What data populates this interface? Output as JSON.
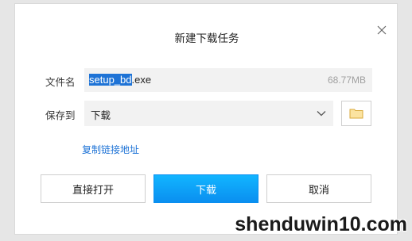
{
  "dialog": {
    "title": "新建下载任务",
    "close_icon": "close-icon"
  },
  "filename": {
    "label": "文件名",
    "value_selected": "setup_bd",
    "value_rest": ".exe",
    "size": "68.77MB"
  },
  "save_to": {
    "label": "保存到",
    "value": "下载",
    "dropdown_icon": "chevron-down-icon",
    "folder_icon": "folder-icon"
  },
  "copy_link": {
    "label": "复制链接地址"
  },
  "buttons": {
    "open_direct": "直接打开",
    "download": "下载",
    "cancel": "取消"
  },
  "watermark": {
    "text": "shenduwin10.com"
  },
  "colors": {
    "accent": "#1e73d6",
    "primary_button": "#0a9cf5",
    "field_bg": "#f2f2f2"
  }
}
